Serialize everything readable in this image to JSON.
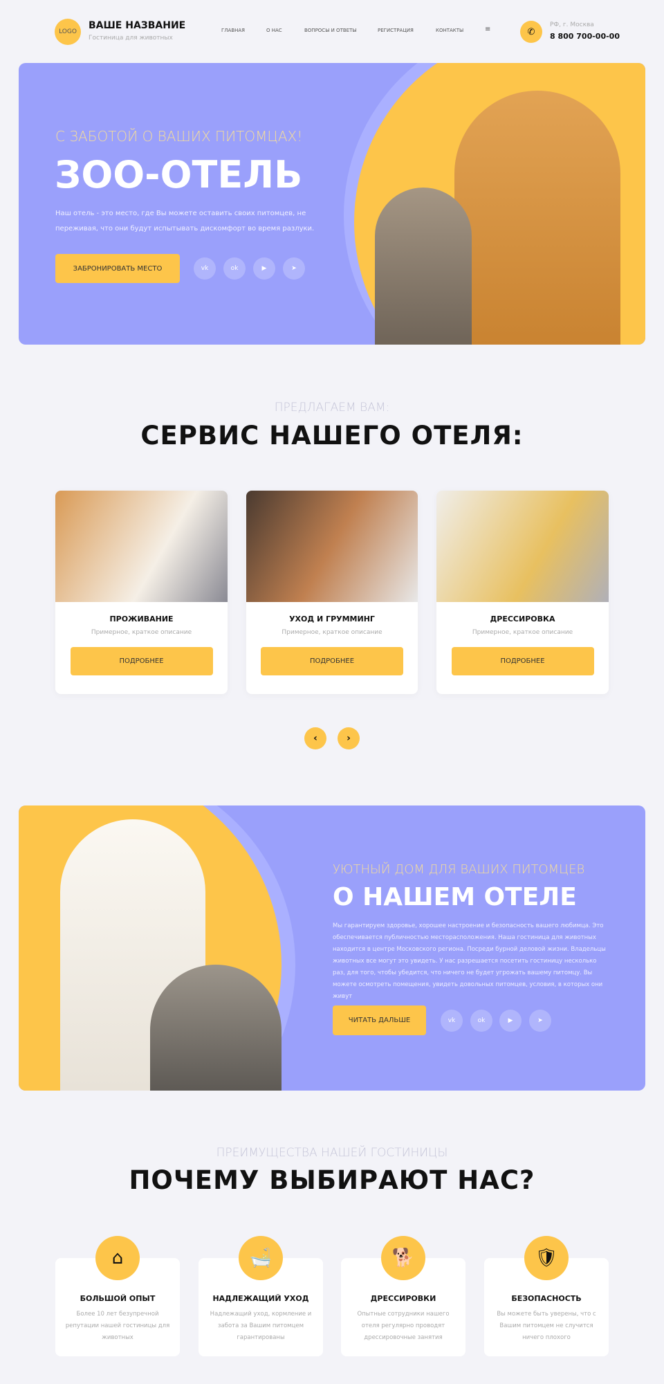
{
  "header": {
    "logo": "LOGO",
    "brand": "ВАШЕ НАЗВАНИЕ",
    "tagline": "Гостиница для животных",
    "nav": [
      "ГЛАВНАЯ",
      "О НАС",
      "ВОПРОСЫ И ОТВЕТЫ",
      "РЕГИСТРАЦИЯ",
      "КОНТАКТЫ",
      "≡"
    ],
    "city": "РФ, г. Москва",
    "phone": "8 800 700-00-00"
  },
  "hero": {
    "subtitle": "С ЗАБОТОЙ О ВАШИХ ПИТОМЦАХ!",
    "title": "ЗОО-ОТЕЛЬ",
    "text": "Наш отель - это место, где Вы можете оставить своих питомцев, не переживая, что они будут испытывать дискомфорт во время разлуки.",
    "button": "ЗАБРОНИРОВАТЬ МЕСТО",
    "social": [
      "vk",
      "ok",
      "yt",
      "tg"
    ]
  },
  "services": {
    "subtitle": "ПРЕДЛАГАЕМ ВАМ:",
    "title": "СЕРВИС НАШЕГО ОТЕЛЯ:",
    "cards": [
      {
        "title": "ПРОЖИВАНИЕ",
        "desc": "Примерное, краткое описание",
        "button": "ПОДРОБНЕЕ"
      },
      {
        "title": "УХОД И ГРУММИНГ",
        "desc": "Примерное, краткое описание",
        "button": "ПОДРОБНЕЕ"
      },
      {
        "title": "ДРЕССИРОВКА",
        "desc": "Примерное, краткое описание",
        "button": "ПОДРОБНЕЕ"
      }
    ],
    "prev": "‹",
    "next": "›"
  },
  "about": {
    "subtitle": "УЮТНЫЙ ДОМ ДЛЯ ВАШИХ ПИТОМЦЕВ",
    "title": "О НАШЕМ ОТЕЛЕ",
    "text": "Мы гарантируем здоровье, хорошее настроение и безопасность вашего любимца. Это обеспечивается публичностью месторасположения. Наша гостиница для животных находится в центре Московского региона. Посреди бурной деловой жизни. Владельцы животных все могут это увидеть. У нас разрешается посетить гостиницу несколько раз, для того, чтобы убедится, что ничего не будет угрожать вашему питомцу. Вы можете осмотреть помещения, увидеть довольных питомцев, условия, в которых они живут",
    "button": "ЧИТАТЬ ДАЛЬШЕ"
  },
  "why": {
    "subtitle": "ПРЕИМУЩЕСТВА НАШЕЙ ГОСТИНИЦЫ",
    "title": "ПОЧЕМУ ВЫБИРАЮТ НАС?",
    "items": [
      {
        "title": "БОЛЬШОЙ ОПЫТ",
        "text": "Более 10 лет безупречной репутации нашей гостиницы для животных",
        "icon": "doghouse-icon"
      },
      {
        "title": "НАДЛЕЖАЩИЙ УХОД",
        "text": "Надлежащий уход, кормление и забота за Вашим питомцем гарантированы",
        "icon": "pet-bath-icon"
      },
      {
        "title": "ДРЕССИРОВКИ",
        "text": "Опытные сотрудники нашего отеля регулярно проводят дрессировочные занятия",
        "icon": "training-icon"
      },
      {
        "title": "БЕЗОПАСНОСТЬ",
        "text": "Вы можете быть уверены, что с Вашим питомцем не случится ничего плохого",
        "icon": "shield-paw-icon"
      }
    ]
  },
  "colors": {
    "accent": "#fdc54a",
    "purple": "#9aa0fb",
    "background": "#f3f3f8"
  }
}
